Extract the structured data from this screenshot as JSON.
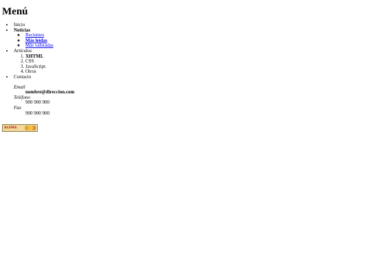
{
  "page": {
    "title": "Menú"
  },
  "menu": {
    "inicio": "Inicio",
    "noticias": {
      "label": "Noticias",
      "items": [
        "Recientes",
        "Más leídas",
        "Más valoradas"
      ]
    },
    "articulos": {
      "label": "Artículos",
      "items": [
        "XHTML",
        "CSS",
        "JavaScript",
        "Otros"
      ]
    },
    "contacto": {
      "label": "Contacto",
      "email_label": "Email",
      "email_value": "nombre@direccion.com",
      "telefono_label": "Teléfono",
      "telefono_value": "900 900 900",
      "fax_label": "Fax",
      "fax_value": "900 900 900"
    }
  },
  "logo": {
    "text": "ALEMA",
    "colors": {
      "text": "#c0282a",
      "background": "#f2d89a",
      "mark": "#f7c94e"
    }
  }
}
